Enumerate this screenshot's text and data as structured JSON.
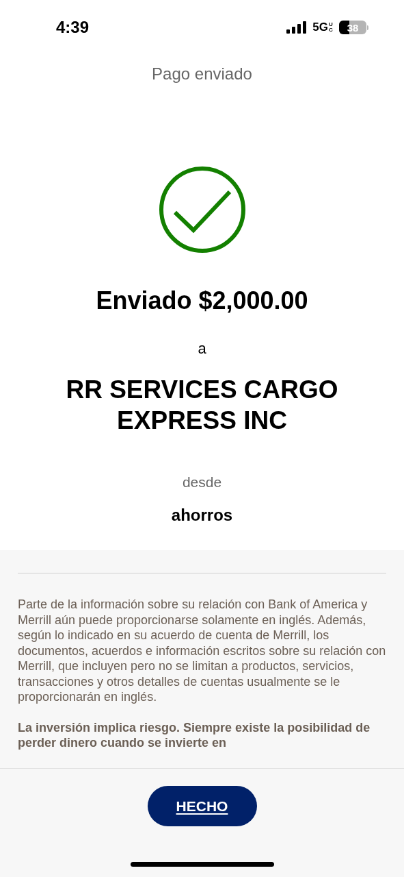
{
  "status_bar": {
    "time": "4:39",
    "network": "5G",
    "network_badge": "UC",
    "battery": "38"
  },
  "header": {
    "title": "Pago enviado"
  },
  "confirmation": {
    "amount_line": "Enviado $2,000.00",
    "to_label": "a",
    "recipient": "RR SERVICES CARGO EXPRESS INC",
    "from_label": "desde",
    "account": "ahorros"
  },
  "disclaimer": {
    "paragraphs": [
      {
        "kind": "normal",
        "text": "Parte de la información sobre su relación con Bank of America y Merrill aún puede proporcionarse solamente en inglés. Además, según lo indicado en su acuerdo de cuenta de Merrill, los documentos, acuerdos e información escritos sobre su relación con Merrill, que incluyen pero no se limitan a productos, servicios, transacciones y otros detalles de cuentas usualmente se le proporcionarán en inglés."
      },
      {
        "kind": "bold",
        "text": "La inversión implica riesgo. Siempre existe la posibilidad de perder dinero cuando se invierte en"
      }
    ]
  },
  "footer": {
    "button": "HECHO"
  }
}
